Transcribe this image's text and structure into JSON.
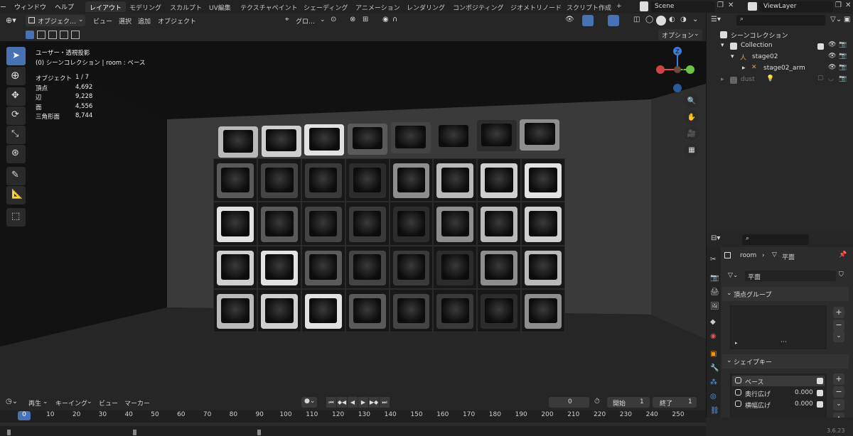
{
  "menu": {
    "window": "ウィンドウ",
    "help": "ヘルプ"
  },
  "workspaces": [
    "レイアウト",
    "モデリング",
    "スカルプト",
    "UV編集",
    "テクスチャペイント",
    "シェーディング",
    "アニメーション",
    "レンダリング",
    "コンポジティング",
    "ジオメトリノード",
    "スクリプト作成"
  ],
  "add_tab": "+",
  "scene": {
    "name": "Scene",
    "viewlayer": "ViewLayer"
  },
  "viewport_header": {
    "mode": "オブジェク…",
    "view": "ビュー",
    "select": "選択",
    "add": "追加",
    "object": "オブジェクト",
    "transform_orient": "グロ…",
    "options": "オプション"
  },
  "overlay": {
    "view_name": "ユーザー・透視投影",
    "collection_info": "(0) シーンコレクション | room : ベース"
  },
  "stats": [
    {
      "label": "オブジェクト",
      "value": "1 / 7"
    },
    {
      "label": "頂点",
      "value": "4,692"
    },
    {
      "label": "辺",
      "value": "9,228"
    },
    {
      "label": "面",
      "value": "4,556"
    },
    {
      "label": "三角形面",
      "value": "8,744"
    }
  ],
  "gizmo": {
    "z": "Z",
    "y": "Y"
  },
  "outliner": {
    "title": "シーンコレクション",
    "rows": [
      {
        "label": "Collection"
      },
      {
        "label": "stage02"
      },
      {
        "label": "stage02_arm"
      },
      {
        "label": "dust"
      }
    ]
  },
  "properties": {
    "object_name": "room",
    "mesh_name": "平面",
    "mesh_field": "平面",
    "vertex_groups_title": "頂点グループ",
    "shape_keys_title": "シェイプキー",
    "shape_keys": [
      {
        "label": "ベース",
        "value": ""
      },
      {
        "label": "奥行広げ",
        "value": "0.000"
      },
      {
        "label": "横幅広げ",
        "value": "0.000"
      }
    ],
    "dots": "⋯"
  },
  "timeline": {
    "playback": "再生",
    "keying": "キーイング",
    "view": "ビュー",
    "marker": "マーカー",
    "current_frame": "0",
    "start_label": "開始",
    "start_value": "1",
    "end_label": "終了",
    "end_value": "1",
    "frames": [
      "0",
      "10",
      "20",
      "30",
      "40",
      "50",
      "60",
      "70",
      "80",
      "90",
      "100",
      "110",
      "120",
      "130",
      "140",
      "150",
      "160",
      "170",
      "180",
      "190",
      "200",
      "210",
      "220",
      "230",
      "240",
      "250"
    ]
  },
  "version": "3.6.23",
  "colors": {
    "accent": "#4772b3",
    "active_tab": "#303030",
    "gizmo_x": "#e04a4a",
    "gizmo_y": "#6ec244",
    "gizmo_z": "#3b7bd9"
  }
}
